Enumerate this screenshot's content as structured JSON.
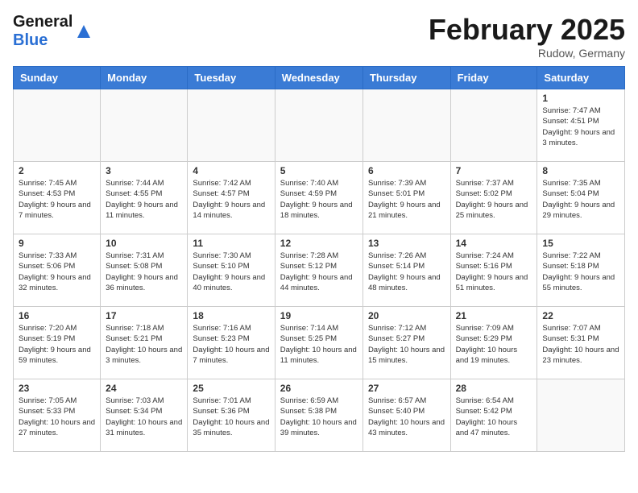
{
  "header": {
    "logo_general": "General",
    "logo_blue": "Blue",
    "month_title": "February 2025",
    "location": "Rudow, Germany"
  },
  "calendar": {
    "days_of_week": [
      "Sunday",
      "Monday",
      "Tuesday",
      "Wednesday",
      "Thursday",
      "Friday",
      "Saturday"
    ],
    "weeks": [
      [
        {
          "day": "",
          "info": ""
        },
        {
          "day": "",
          "info": ""
        },
        {
          "day": "",
          "info": ""
        },
        {
          "day": "",
          "info": ""
        },
        {
          "day": "",
          "info": ""
        },
        {
          "day": "",
          "info": ""
        },
        {
          "day": "1",
          "info": "Sunrise: 7:47 AM\nSunset: 4:51 PM\nDaylight: 9 hours and 3 minutes."
        }
      ],
      [
        {
          "day": "2",
          "info": "Sunrise: 7:45 AM\nSunset: 4:53 PM\nDaylight: 9 hours and 7 minutes."
        },
        {
          "day": "3",
          "info": "Sunrise: 7:44 AM\nSunset: 4:55 PM\nDaylight: 9 hours and 11 minutes."
        },
        {
          "day": "4",
          "info": "Sunrise: 7:42 AM\nSunset: 4:57 PM\nDaylight: 9 hours and 14 minutes."
        },
        {
          "day": "5",
          "info": "Sunrise: 7:40 AM\nSunset: 4:59 PM\nDaylight: 9 hours and 18 minutes."
        },
        {
          "day": "6",
          "info": "Sunrise: 7:39 AM\nSunset: 5:01 PM\nDaylight: 9 hours and 21 minutes."
        },
        {
          "day": "7",
          "info": "Sunrise: 7:37 AM\nSunset: 5:02 PM\nDaylight: 9 hours and 25 minutes."
        },
        {
          "day": "8",
          "info": "Sunrise: 7:35 AM\nSunset: 5:04 PM\nDaylight: 9 hours and 29 minutes."
        }
      ],
      [
        {
          "day": "9",
          "info": "Sunrise: 7:33 AM\nSunset: 5:06 PM\nDaylight: 9 hours and 32 minutes."
        },
        {
          "day": "10",
          "info": "Sunrise: 7:31 AM\nSunset: 5:08 PM\nDaylight: 9 hours and 36 minutes."
        },
        {
          "day": "11",
          "info": "Sunrise: 7:30 AM\nSunset: 5:10 PM\nDaylight: 9 hours and 40 minutes."
        },
        {
          "day": "12",
          "info": "Sunrise: 7:28 AM\nSunset: 5:12 PM\nDaylight: 9 hours and 44 minutes."
        },
        {
          "day": "13",
          "info": "Sunrise: 7:26 AM\nSunset: 5:14 PM\nDaylight: 9 hours and 48 minutes."
        },
        {
          "day": "14",
          "info": "Sunrise: 7:24 AM\nSunset: 5:16 PM\nDaylight: 9 hours and 51 minutes."
        },
        {
          "day": "15",
          "info": "Sunrise: 7:22 AM\nSunset: 5:18 PM\nDaylight: 9 hours and 55 minutes."
        }
      ],
      [
        {
          "day": "16",
          "info": "Sunrise: 7:20 AM\nSunset: 5:19 PM\nDaylight: 9 hours and 59 minutes."
        },
        {
          "day": "17",
          "info": "Sunrise: 7:18 AM\nSunset: 5:21 PM\nDaylight: 10 hours and 3 minutes."
        },
        {
          "day": "18",
          "info": "Sunrise: 7:16 AM\nSunset: 5:23 PM\nDaylight: 10 hours and 7 minutes."
        },
        {
          "day": "19",
          "info": "Sunrise: 7:14 AM\nSunset: 5:25 PM\nDaylight: 10 hours and 11 minutes."
        },
        {
          "day": "20",
          "info": "Sunrise: 7:12 AM\nSunset: 5:27 PM\nDaylight: 10 hours and 15 minutes."
        },
        {
          "day": "21",
          "info": "Sunrise: 7:09 AM\nSunset: 5:29 PM\nDaylight: 10 hours and 19 minutes."
        },
        {
          "day": "22",
          "info": "Sunrise: 7:07 AM\nSunset: 5:31 PM\nDaylight: 10 hours and 23 minutes."
        }
      ],
      [
        {
          "day": "23",
          "info": "Sunrise: 7:05 AM\nSunset: 5:33 PM\nDaylight: 10 hours and 27 minutes."
        },
        {
          "day": "24",
          "info": "Sunrise: 7:03 AM\nSunset: 5:34 PM\nDaylight: 10 hours and 31 minutes."
        },
        {
          "day": "25",
          "info": "Sunrise: 7:01 AM\nSunset: 5:36 PM\nDaylight: 10 hours and 35 minutes."
        },
        {
          "day": "26",
          "info": "Sunrise: 6:59 AM\nSunset: 5:38 PM\nDaylight: 10 hours and 39 minutes."
        },
        {
          "day": "27",
          "info": "Sunrise: 6:57 AM\nSunset: 5:40 PM\nDaylight: 10 hours and 43 minutes."
        },
        {
          "day": "28",
          "info": "Sunrise: 6:54 AM\nSunset: 5:42 PM\nDaylight: 10 hours and 47 minutes."
        },
        {
          "day": "",
          "info": ""
        }
      ]
    ]
  }
}
